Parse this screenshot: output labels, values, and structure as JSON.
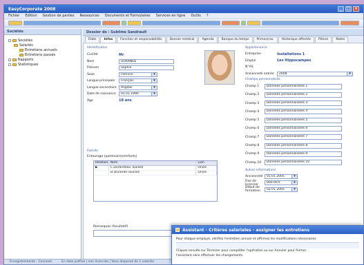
{
  "window": {
    "title": "EasyCorporate 2008"
  },
  "menubar": [
    "Fichier",
    "Edition",
    "Gestion de parties",
    "Ressources",
    "Documents et Formulaires",
    "Services en ligne",
    "Outils",
    "?"
  ],
  "toolbar_icons": [
    "new-icon",
    "open-icon",
    "save-icon",
    "print-icon",
    "cut-icon",
    "copy-icon",
    "paste-icon",
    "undo-icon",
    "redo-icon",
    "find-icon",
    "help-icon"
  ],
  "left_panel": {
    "header": "Sociétés",
    "tree": [
      {
        "label": "Sociétés",
        "level": 0
      },
      {
        "label": "Salariés",
        "level": 1
      },
      {
        "label": "Entretiens annuels",
        "level": 2
      },
      {
        "label": "Entretiens passés",
        "level": 2
      },
      {
        "label": "Rapports",
        "level": 0
      },
      {
        "label": "Statistiques",
        "level": 0
      }
    ]
  },
  "main": {
    "header": "Dossier de : Sublime Sandrault",
    "tabs": [
      "Etats",
      "Infos",
      "Fonction et responsabilités",
      "Dossier médical",
      "Agenda",
      "Banque du temps",
      "Primes/rav.",
      "Historique affectés",
      "Pièces",
      "Notes"
    ],
    "active_tab": "Infos",
    "identity": {
      "section_title": "Identification",
      "fields": [
        {
          "label": "Civilité",
          "value": "Mr",
          "type": "text"
        },
        {
          "label": "Nom",
          "value": "DURANDE",
          "type": "input"
        },
        {
          "label": "Prénom",
          "value": "Sophie",
          "type": "input"
        },
        {
          "label": "Sexe",
          "value": "Féminin",
          "type": "select"
        },
        {
          "label": "Langue principale",
          "value": "Français",
          "type": "select"
        },
        {
          "label": "Langue secondaire",
          "value": "Anglais",
          "type": "select"
        },
        {
          "label": "Date de naissance",
          "value": "01.01.1990",
          "type": "select"
        },
        {
          "label": "Âge",
          "value": "18 ans",
          "type": "text"
        }
      ]
    },
    "family": {
      "section_title": "Famille",
      "subtitle": "Entourage (partenaires/enfants)",
      "columns": [
        "Relation",
        "Nom",
        "Lien"
      ],
      "rows": [
        {
          "relation": "▶",
          "name": "C.Durandeau Toulliez",
          "link": "Oncle"
        },
        {
          "relation": "",
          "name": "D.Durande Toulliez",
          "link": "Oncle"
        }
      ]
    },
    "comments_label": "Remarques (facultatif)",
    "organisation": {
      "section_title": "Appartenance",
      "fields": [
        {
          "label": "Entreprise",
          "value": "Installations 1"
        },
        {
          "label": "Emploi",
          "value": "Les Hippocampes"
        },
        {
          "label": "N°AS",
          "value": ""
        },
        {
          "label": "Ancienneté entrée",
          "value": "2008"
        }
      ]
    },
    "custom_fields": {
      "section_title": "Champs personnalisés",
      "rows": [
        {
          "label": "Champ 1",
          "value": "Données personnalisées 1"
        },
        {
          "label": "Champ 2",
          "value": "Données personnalisées 2"
        },
        {
          "label": "Champ 3",
          "value": "Données personnalisées 3"
        },
        {
          "label": "Champ 4",
          "value": "Données personnalisées 4"
        },
        {
          "label": "Champ 5",
          "value": "Données personnalisées 5"
        },
        {
          "label": "Champ 6",
          "value": "Données personnalisées 6"
        },
        {
          "label": "Champ 7",
          "value": "Données personnalisées 7"
        },
        {
          "label": "Champ 8",
          "value": "Données personnalisées 8"
        },
        {
          "label": "Champ 9",
          "value": "Données personnalisées 9"
        },
        {
          "label": "Champ 10",
          "value": "Données personnalisées 10"
        }
      ]
    },
    "dates": {
      "section_title": "Autres informations",
      "rows": [
        {
          "label": "Ancienneté",
          "value": "01.01.2005"
        },
        {
          "label": "Fixe de licencier",
          "value": "000.00 €"
        },
        {
          "label": "Début de formation",
          "value": "02.01.2005"
        }
      ]
    }
  },
  "statusbar": [
    "Enregistrements : Connexé",
    "En date préfixe | non licenciés | Vous disposez de 1 salariés"
  ],
  "dialog": {
    "title": "Assistant - Critères salariales - assigner les entretiens",
    "line1": "Pour chaque employé, vérifiez l'entretien annuel et affirmez les modifications nécessaires",
    "line2": "Cliquez ensuite sur Terminer pour compléter l'opération ou sur Annuler pour fermer",
    "line3": "l'assistant sans effectuer les changements."
  },
  "colors": {
    "accent": "#2a5cc0",
    "background": "#c9a9d6",
    "panel": "#cfdcf1"
  }
}
